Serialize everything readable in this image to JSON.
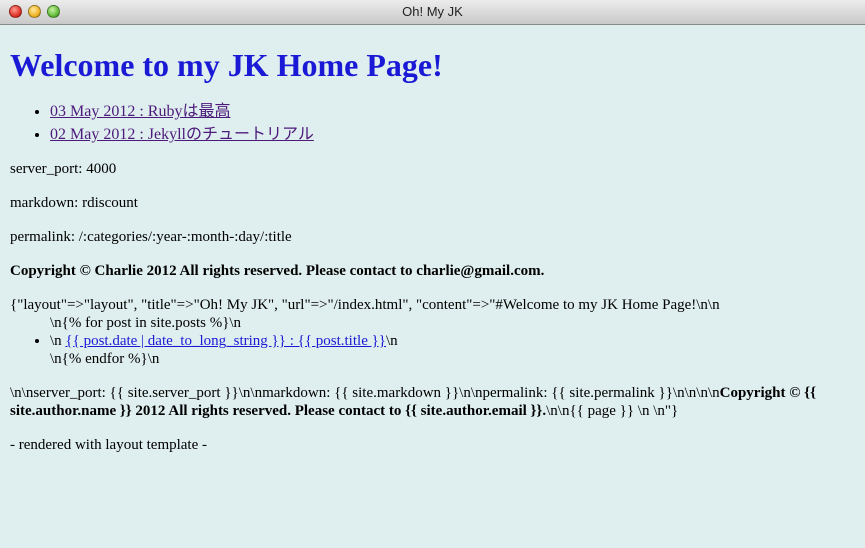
{
  "window": {
    "title": "Oh! My JK"
  },
  "page": {
    "heading": "Welcome to my JK Home Page!",
    "posts": [
      {
        "label": "03 May 2012 : Rubyは最高"
      },
      {
        "label": "02 May 2012 : Jekyllのチュートリアル"
      }
    ],
    "server_port": "server_port: 4000",
    "markdown": "markdown: rdiscount",
    "permalink": "permalink: /:categories/:year-:month-:day/:title",
    "copyright": "Copyright © Charlie 2012 All rights reserved. Please contact to charlie@gmail.com.",
    "raw_dump": {
      "line1": "{\"layout\"=>\"layout\", \"title\"=>\"Oh! My JK\", \"url\"=>\"/index.html\", \"content\"=>\"#Welcome to my JK Home Page!\\n\\n",
      "loop_start": "\\n{% for post in site.posts %}\\n",
      "item_prefix": "\\n ",
      "item_link": "{{ post.date | date_to_long_string }} : {{ post.title }}",
      "item_suffix": "\\n",
      "loop_end": "\\n{% endfor %}\\n",
      "tail_plain": "\\n\\nserver_port: {{ site.server_port }}\\n\\nmarkdown: {{ site.markdown }}\\n\\npermalink: {{ site.permalink }}\\n\\n\\n\\n",
      "tail_bold": "Copyright © {{ site.author.name }} 2012 All rights reserved. Please contact to {{ site.author.email }}.",
      "tail_end": "\\n\\n{{ page }} \\n \\n\"}"
    },
    "footer": "- rendered with layout template -"
  },
  "colors": {
    "background": "#dfeeee",
    "heading": "#1a1ad6",
    "visited_link": "#4b1a7a",
    "link": "#1a1ad6"
  }
}
